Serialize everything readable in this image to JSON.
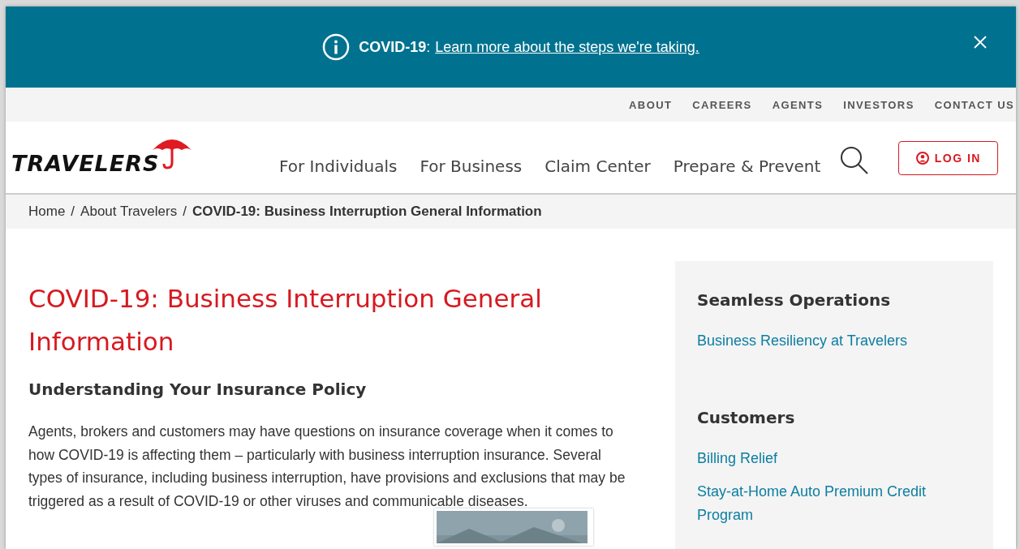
{
  "alert_banner": {
    "label": "COVID-19",
    "separator": ":",
    "link": "Learn more about the steps we're taking."
  },
  "utility_nav": [
    "ABOUT",
    "CAREERS",
    "AGENTS",
    "INVESTORS",
    "CONTACT US"
  ],
  "logo": {
    "text": "TRAVELERS"
  },
  "main_nav": [
    "For Individuals",
    "For Business",
    "Claim Center",
    "Prepare & Prevent"
  ],
  "login_button": "LOG IN",
  "breadcrumb": [
    {
      "label": "Home",
      "current": false
    },
    {
      "label": "About Travelers",
      "current": false
    },
    {
      "label": "COVID-19: Business Interruption General Information",
      "current": true
    }
  ],
  "breadcrumb_separator": "/",
  "article": {
    "title": "COVID-19: Business Interruption General Information",
    "subheading": "Understanding Your Insurance Policy",
    "paragraph": "Agents, brokers and customers may have questions on insurance coverage when it comes to how COVID-19 is affecting them – particularly with business interruption insurance. Several types of insurance, including business interruption, have provisions and exclusions that may be triggered as a result of COVID-19 or other viruses and communicable diseases."
  },
  "sidebar": {
    "sections": [
      {
        "heading": "Seamless Operations",
        "links": [
          "Business Resiliency at Travelers"
        ]
      },
      {
        "heading": "Customers",
        "links": [
          "Billing Relief",
          "Stay-at-Home Auto Premium Credit Program"
        ]
      }
    ]
  }
}
